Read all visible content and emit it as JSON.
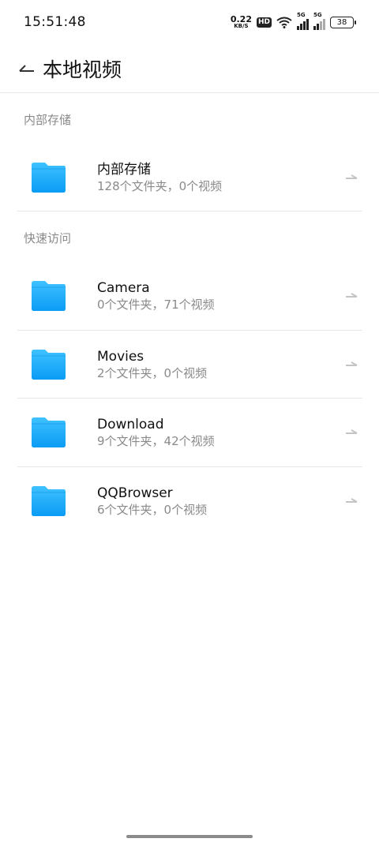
{
  "status_bar": {
    "time": "15:51:48",
    "net_speed_value": "0.22",
    "net_speed_unit": "KB/S",
    "hd_label": "HD",
    "sim1_label": "5G",
    "sim2_label": "5G",
    "battery_level": "38"
  },
  "app_bar": {
    "title": "本地视频",
    "back_icon": "back-arrow-icon"
  },
  "sections": {
    "internal": {
      "header": "内部存储",
      "items": [
        {
          "name": "内部存储",
          "detail": "128个文件夹，0个视频"
        }
      ]
    },
    "quick_access": {
      "header": "快速访问",
      "items": [
        {
          "name": "Camera",
          "detail": "0个文件夹，71个视频"
        },
        {
          "name": "Movies",
          "detail": "2个文件夹，0个视频"
        },
        {
          "name": "Download",
          "detail": "9个文件夹，42个视频"
        },
        {
          "name": "QQBrowser",
          "detail": "6个文件夹，0个视频"
        }
      ]
    }
  },
  "colors": {
    "folder_blue_top": "#3fc2ff",
    "folder_blue_bottom": "#0a9cf5",
    "secondary_text": "#8a8a8a"
  }
}
